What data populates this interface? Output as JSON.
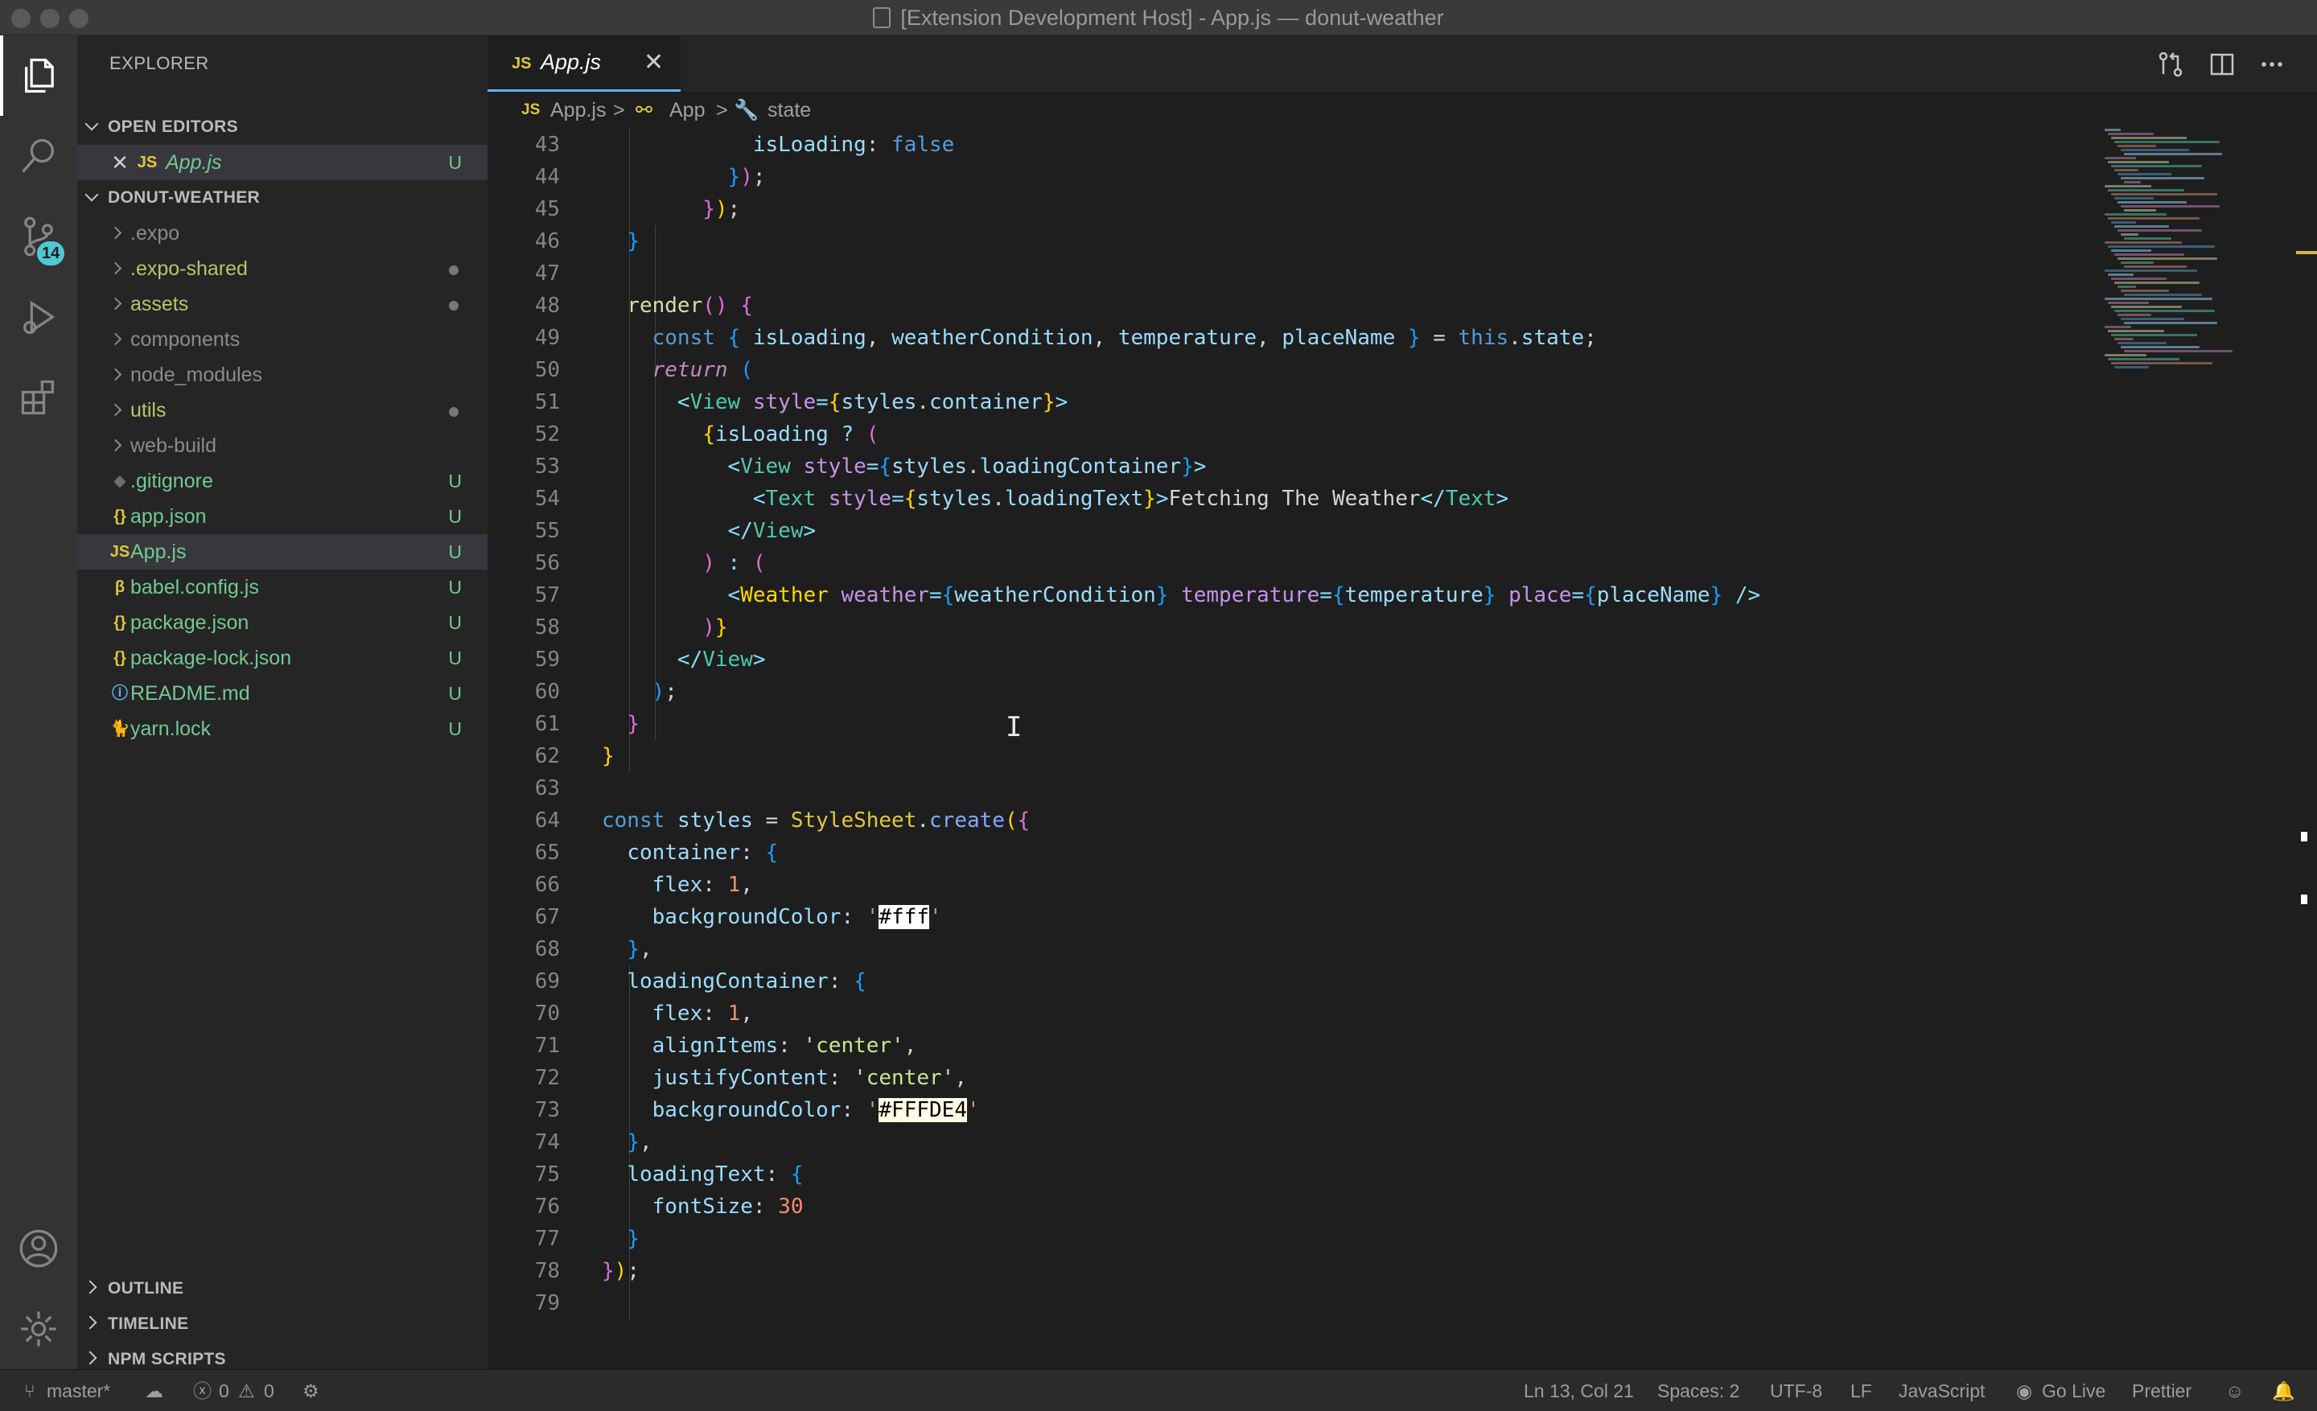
{
  "window": {
    "title": "[Extension Development Host] - App.js — donut-weather"
  },
  "activity_bar": {
    "items": [
      {
        "name": "explorer-icon"
      },
      {
        "name": "search-icon"
      },
      {
        "name": "source-control-icon",
        "badge": "14"
      },
      {
        "name": "run-debug-icon"
      },
      {
        "name": "extensions-icon"
      }
    ],
    "bottom": [
      {
        "name": "account-icon"
      },
      {
        "name": "gear-icon"
      }
    ]
  },
  "sidebar": {
    "title": "EXPLORER",
    "open_editors": {
      "header": "OPEN EDITORS",
      "items": [
        {
          "icon": "JS",
          "label": "App.js",
          "status": "U"
        }
      ]
    },
    "project": {
      "header": "DONUT-WEATHER",
      "items": [
        {
          "kind": "folder",
          "label": ".expo",
          "status": ""
        },
        {
          "kind": "folder",
          "label": ".expo-shared",
          "status": "dot"
        },
        {
          "kind": "folder",
          "label": "assets",
          "status": "dot"
        },
        {
          "kind": "folder",
          "label": "components",
          "status": ""
        },
        {
          "kind": "folder",
          "label": "node_modules",
          "status": ""
        },
        {
          "kind": "folder",
          "label": "utils",
          "status": "dot"
        },
        {
          "kind": "folder",
          "label": "web-build",
          "status": ""
        },
        {
          "kind": "file",
          "icon": "◆",
          "label": ".gitignore",
          "status": "U"
        },
        {
          "kind": "file",
          "icon": "{}",
          "label": "app.json",
          "status": "U"
        },
        {
          "kind": "file",
          "icon": "JS",
          "label": "App.js",
          "status": "U"
        },
        {
          "kind": "file",
          "icon": "β",
          "label": "babel.config.js",
          "status": "U"
        },
        {
          "kind": "file",
          "icon": "{}",
          "label": "package.json",
          "status": "U"
        },
        {
          "kind": "file",
          "icon": "{}",
          "label": "package-lock.json",
          "status": "U"
        },
        {
          "kind": "file",
          "icon": "ⓘ",
          "label": "README.md",
          "status": "U"
        },
        {
          "kind": "file",
          "icon": "🐈",
          "label": "yarn.lock",
          "status": "U"
        }
      ]
    },
    "bottom_sections": [
      "OUTLINE",
      "TIMELINE",
      "NPM SCRIPTS"
    ]
  },
  "editor": {
    "tab": {
      "icon": "JS",
      "label": "App.js",
      "close": "✕"
    },
    "breadcrumb": {
      "icon": "JS",
      "file": "App.js",
      "sep": ">",
      "symbol1": "App",
      "symbol2": "state"
    },
    "first_line": 43,
    "line_numbers": [
      "43",
      "44",
      "45",
      "46",
      "47",
      "48",
      "49",
      "50",
      "51",
      "52",
      "53",
      "54",
      "55",
      "56",
      "57",
      "58",
      "59",
      "60",
      "61",
      "62",
      "63",
      "64",
      "65",
      "66",
      "67",
      "68",
      "69",
      "70",
      "71",
      "72",
      "73",
      "74",
      "75",
      "76",
      "77",
      "78",
      "79"
    ]
  },
  "statusbar": {
    "branch": "master*",
    "sync_icon": "sync-icon",
    "errors": "0",
    "warnings": "0",
    "position": "Ln 13, Col 21",
    "spaces": "Spaces: 2",
    "encoding": "UTF-8",
    "eol": "LF",
    "language": "JavaScript",
    "golive": "Go Live",
    "prettier": "Prettier"
  },
  "colors": {
    "accent": "#5fb3f0",
    "badge": "#4dc9d6",
    "untracked": "#73c991",
    "js_icon": "#e2c640"
  }
}
